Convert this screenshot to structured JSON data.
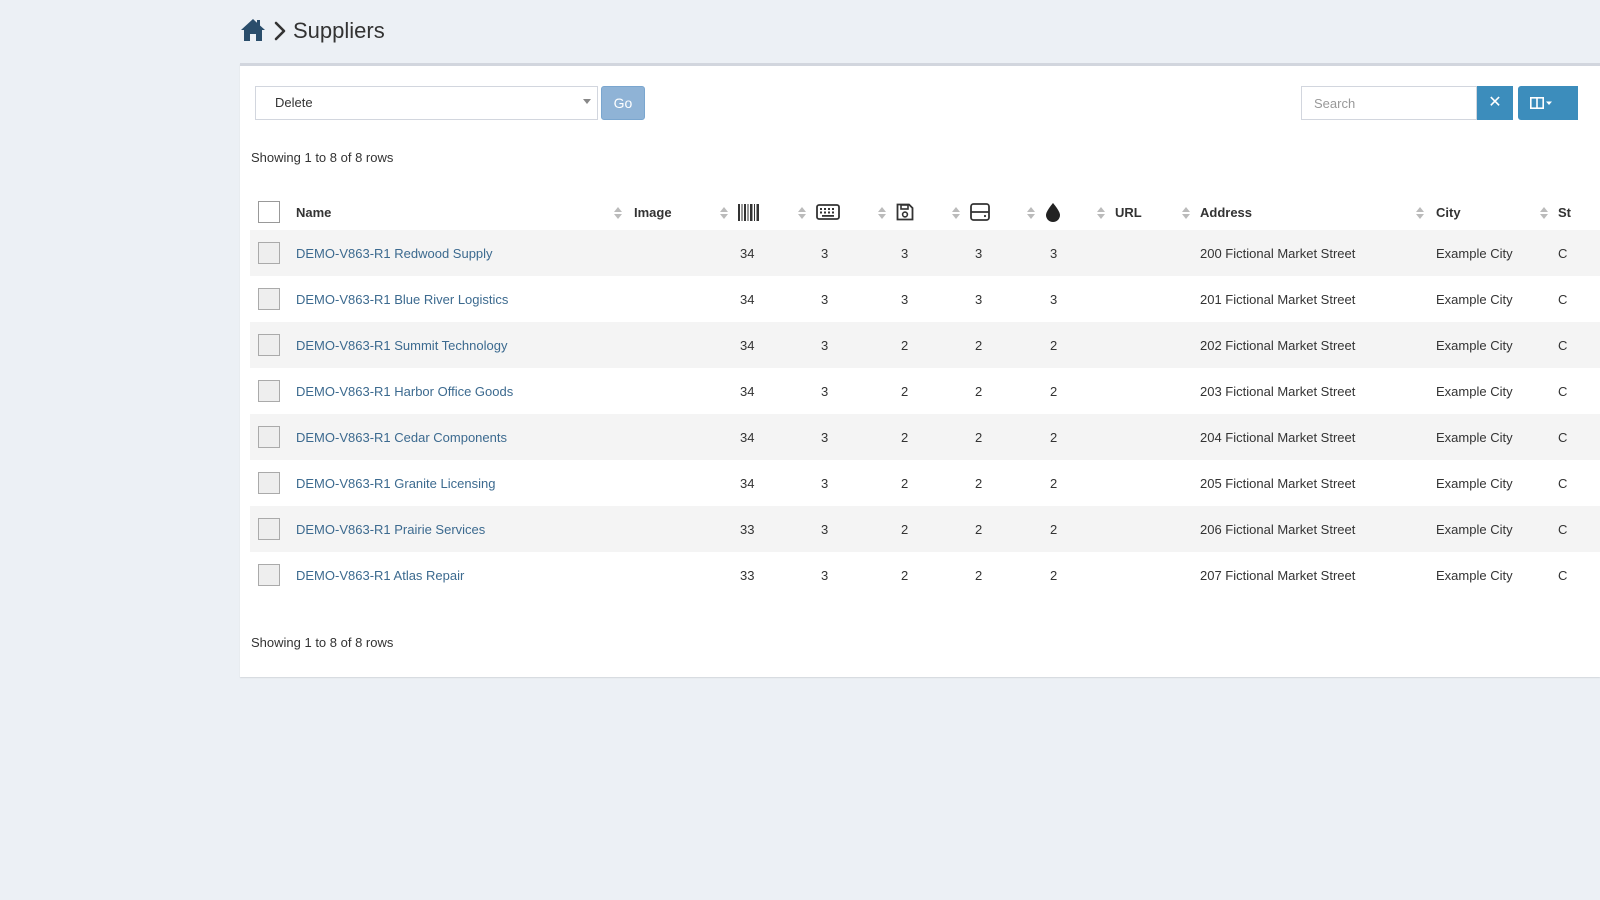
{
  "breadcrumb": {
    "home_icon": "home-icon",
    "separator_icon": "chevron-right-icon",
    "title": "Suppliers"
  },
  "toolbar": {
    "bulk_action": "Delete",
    "go_label": "Go",
    "search_placeholder": "Search",
    "clear_label": "✕",
    "columns_icon": "columns-icon"
  },
  "pagination": {
    "top_text": "Showing 1 to 8 of 8 rows",
    "bottom_text": "Showing 1 to 8 of 8 rows"
  },
  "table": {
    "headers": {
      "name": "Name",
      "image": "Image",
      "assets_icon": "barcode-icon",
      "accessories_icon": "keyboard-icon",
      "licenses_icon": "floppy-disk-icon",
      "components_icon": "hard-drive-icon",
      "consumables_icon": "tint-drop-icon",
      "url": "URL",
      "address": "Address",
      "city": "City",
      "state": "St"
    },
    "rows": [
      {
        "name": "DEMO-V863-R1 Redwood Supply",
        "assets": "34",
        "accessories": "3",
        "licenses": "3",
        "components": "3",
        "consumables": "3",
        "address": "200 Fictional Market Street",
        "city": "Example City",
        "state": "C"
      },
      {
        "name": "DEMO-V863-R1 Blue River Logistics",
        "assets": "34",
        "accessories": "3",
        "licenses": "3",
        "components": "3",
        "consumables": "3",
        "address": "201 Fictional Market Street",
        "city": "Example City",
        "state": "C"
      },
      {
        "name": "DEMO-V863-R1 Summit Technology",
        "assets": "34",
        "accessories": "3",
        "licenses": "2",
        "components": "2",
        "consumables": "2",
        "address": "202 Fictional Market Street",
        "city": "Example City",
        "state": "C"
      },
      {
        "name": "DEMO-V863-R1 Harbor Office Goods",
        "assets": "34",
        "accessories": "3",
        "licenses": "2",
        "components": "2",
        "consumables": "2",
        "address": "203 Fictional Market Street",
        "city": "Example City",
        "state": "C"
      },
      {
        "name": "DEMO-V863-R1 Cedar Components",
        "assets": "34",
        "accessories": "3",
        "licenses": "2",
        "components": "2",
        "consumables": "2",
        "address": "204 Fictional Market Street",
        "city": "Example City",
        "state": "C"
      },
      {
        "name": "DEMO-V863-R1 Granite Licensing",
        "assets": "34",
        "accessories": "3",
        "licenses": "2",
        "components": "2",
        "consumables": "2",
        "address": "205 Fictional Market Street",
        "city": "Example City",
        "state": "C"
      },
      {
        "name": "DEMO-V863-R1 Prairie Services",
        "assets": "33",
        "accessories": "3",
        "licenses": "2",
        "components": "2",
        "consumables": "2",
        "address": "206 Fictional Market Street",
        "city": "Example City",
        "state": "C"
      },
      {
        "name": "DEMO-V863-R1 Atlas Repair",
        "assets": "33",
        "accessories": "3",
        "licenses": "2",
        "components": "2",
        "consumables": "2",
        "address": "207 Fictional Market Street",
        "city": "Example City",
        "state": "C"
      }
    ]
  },
  "colors": {
    "link": "#3c6a8f",
    "primary": "#3c8dbc",
    "go_disabled": "#8fb3d6",
    "background": "#ecf0f5"
  }
}
